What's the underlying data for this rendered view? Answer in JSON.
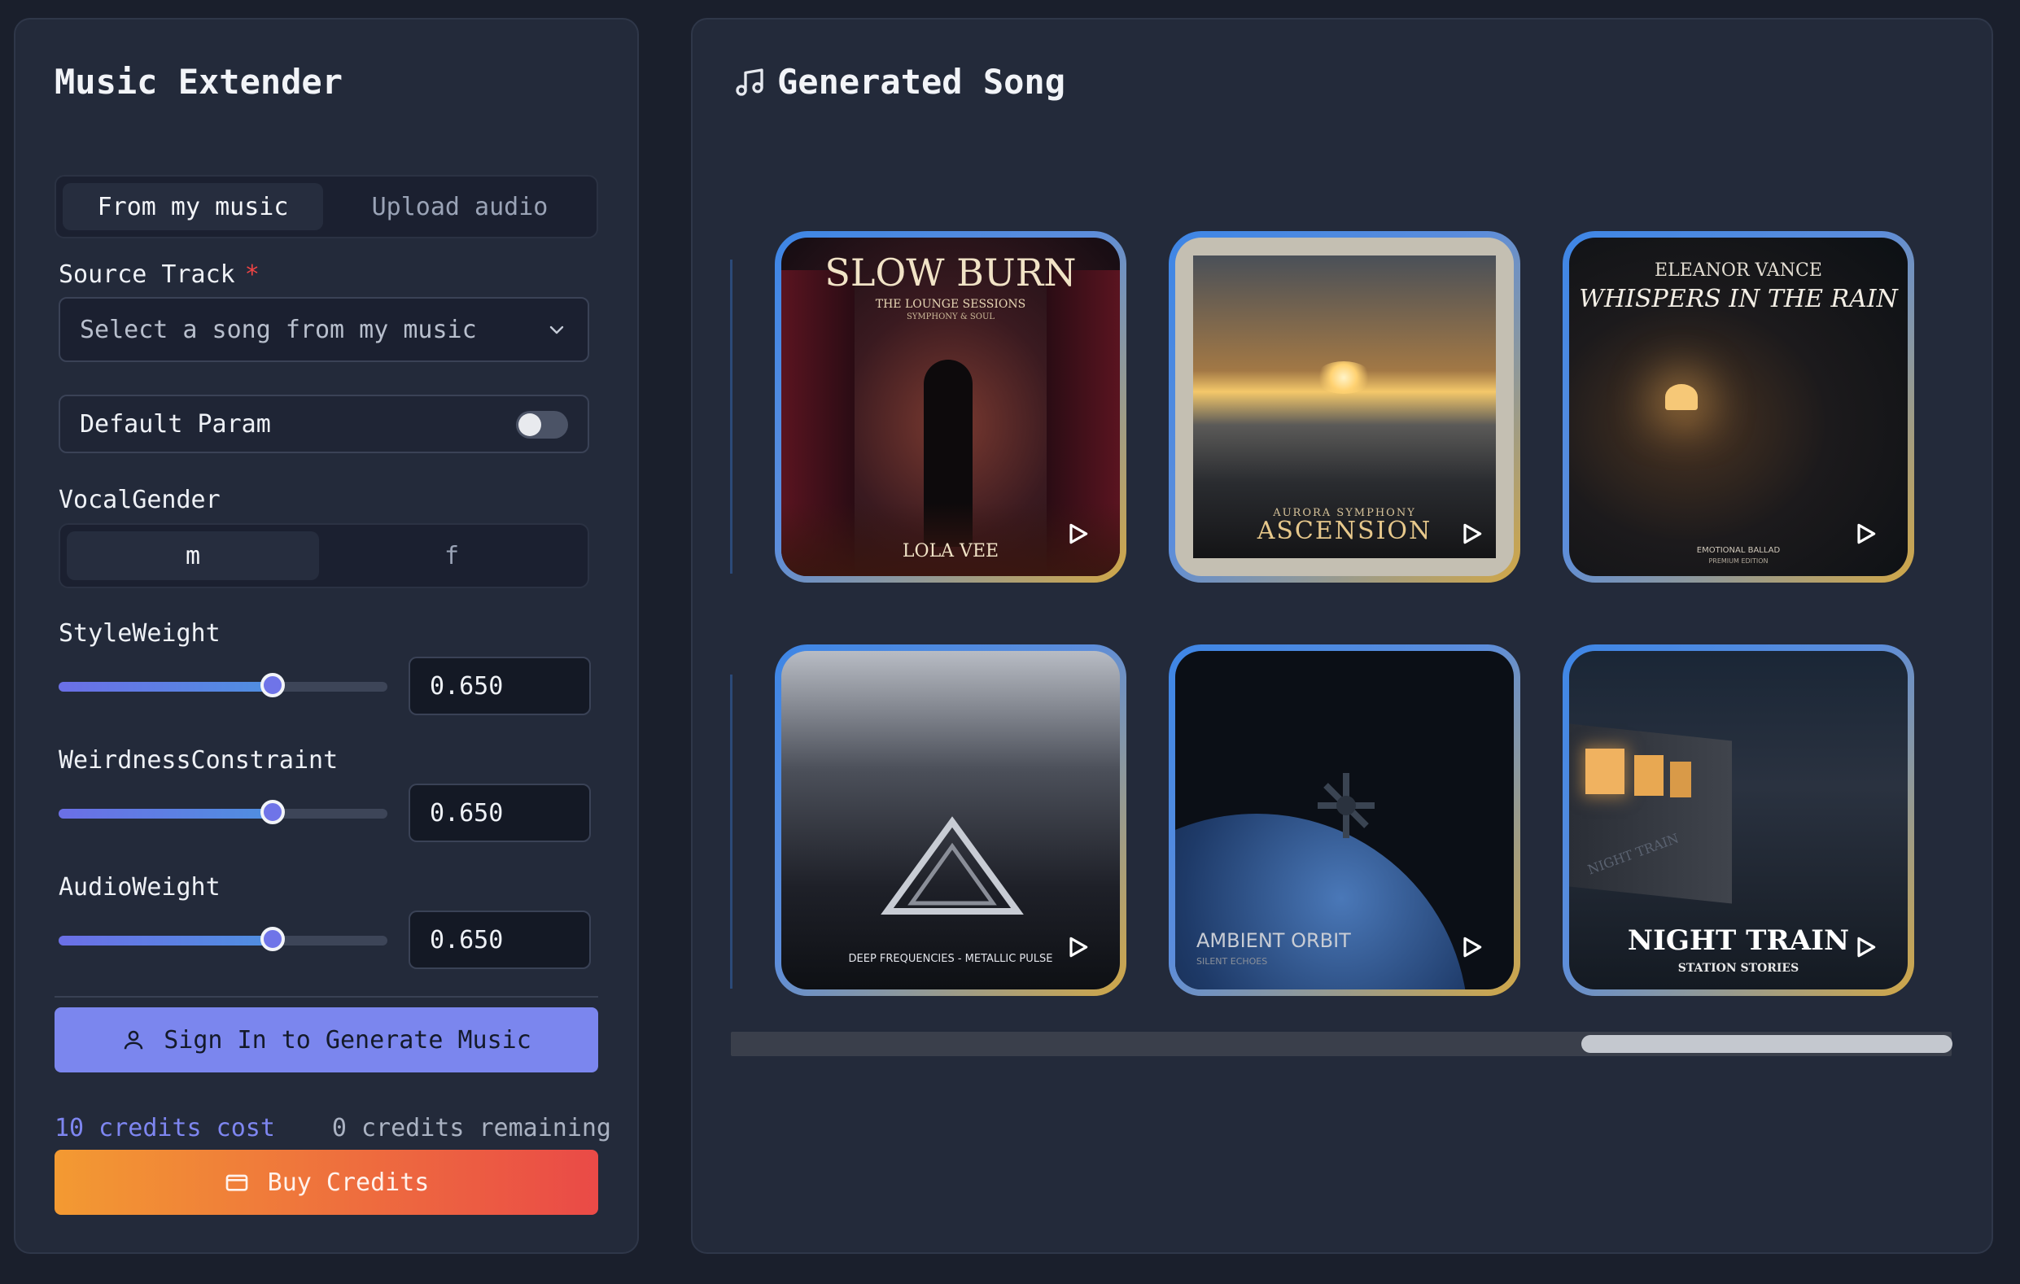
{
  "left": {
    "title": "Music Extender",
    "tabs": [
      "From my music",
      "Upload audio"
    ],
    "source_track": {
      "label": "Source Track",
      "required_mark": "*",
      "placeholder": "Select a song from my music"
    },
    "default_param": {
      "label": "Default Param",
      "enabled": false
    },
    "vocal_gender": {
      "label": "VocalGender",
      "options": [
        "m",
        "f"
      ],
      "selected": "m"
    },
    "style_weight": {
      "label": "StyleWeight",
      "value": "0.650",
      "fraction": 0.65
    },
    "weirdness": {
      "label": "WeirdnessConstraint",
      "value": "0.650",
      "fraction": 0.65
    },
    "audio_weight": {
      "label": "AudioWeight",
      "value": "0.650",
      "fraction": 0.65
    },
    "sign_in_label": "Sign In to Generate Music",
    "credits_cost": "10 credits cost",
    "credits_remaining": "0 credits remaining",
    "buy_label": "Buy Credits"
  },
  "right": {
    "title": "Generated Song",
    "songs": [
      {
        "title": "SLOW BURN",
        "subtitle": "THE LOUNGE SESSIONS",
        "sub2": "SYMPHONY & SOUL",
        "artist": "LOLA VEE"
      },
      {
        "title": "ASCENSION",
        "artist": "AURORA SYMPHONY"
      },
      {
        "title": "WHISPERS IN THE RAIN",
        "artist": "ELEANOR VANCE",
        "sub": "EMOTIONAL BALLAD",
        "sub2": "PREMIUM EDITION"
      },
      {
        "title": "DEEP FREQUENCIES - METALLIC PULSE"
      },
      {
        "title": "AMBIENT ORBIT",
        "subtitle": "SILENT ECHOES"
      },
      {
        "title": "NIGHT TRAIN",
        "subtitle": "STATION STORIES",
        "tag": "NIGHT TRAIN"
      }
    ]
  },
  "colors": {
    "accent": "#7b86ee",
    "buy_start": "#f39a32",
    "buy_end": "#ea4a47",
    "required": "#ef4444"
  }
}
